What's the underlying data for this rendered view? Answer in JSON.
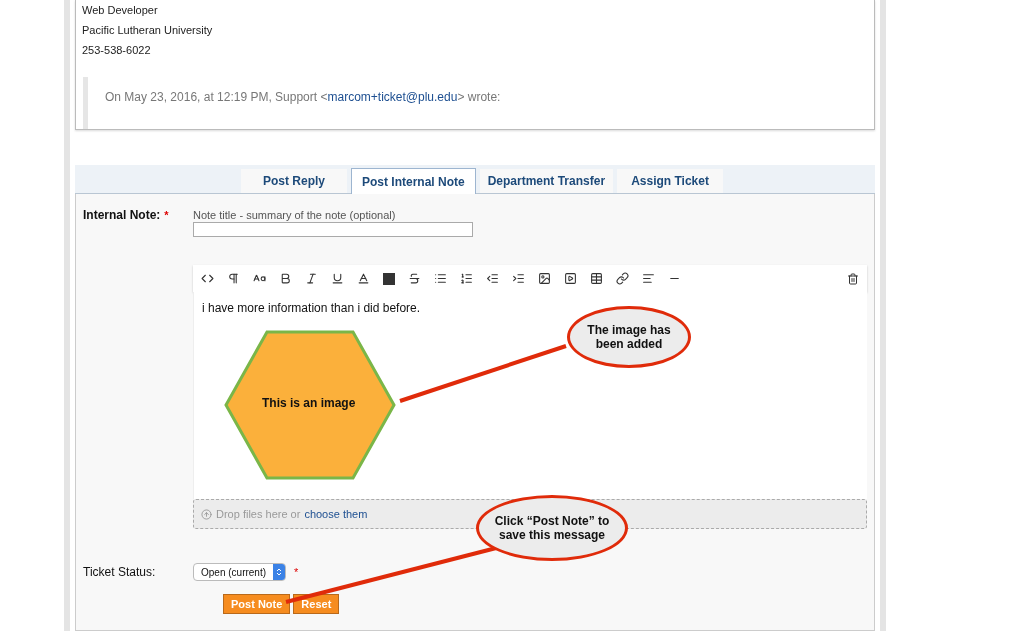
{
  "message": {
    "lines": [
      "Web Developer",
      "Pacific Lutheran University",
      "253-538-6022"
    ],
    "quote": {
      "before": "On May 23, 2016, at 12:19 PM, Support <",
      "link": "marcom+ticket@plu.edu",
      "after": "> wrote:"
    }
  },
  "tabs": [
    {
      "label": "Post Reply",
      "selected": false
    },
    {
      "label": "Post Internal Note",
      "selected": true
    },
    {
      "label": "Department Transfer",
      "selected": false
    },
    {
      "label": "Assign Ticket",
      "selected": false
    }
  ],
  "internal_note": {
    "label": "Internal Note:",
    "required_mark": "*",
    "title_caption": "Note title - summary of the note (optional)"
  },
  "editor": {
    "text": "i have more information than i did before.",
    "image_caption": "This is an image",
    "dropzone": {
      "text": "Drop files here or",
      "link": "choose them"
    }
  },
  "ticket_status": {
    "label": "Ticket Status:",
    "value": "Open (current)",
    "required_mark": "*"
  },
  "buttons": [
    "Post Note",
    "Reset"
  ],
  "callouts": [
    {
      "text": "The image has been added"
    },
    {
      "text": "Click “Post Note” to save this message"
    }
  ]
}
